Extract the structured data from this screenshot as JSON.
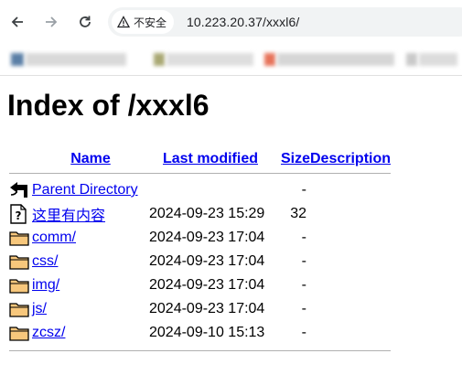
{
  "browser": {
    "security_label": "不安全",
    "url": "10.223.20.37/xxxl6/"
  },
  "page": {
    "title": "Index of /xxxl6",
    "headers": {
      "name": "Name",
      "last_modified": "Last modified",
      "size": "Size",
      "description": "Description"
    },
    "rows": [
      {
        "icon": "back-icon",
        "name": "Parent Directory",
        "date": "",
        "size": "-"
      },
      {
        "icon": "unknown-file-icon",
        "name": "这里有内容",
        "date": "2024-09-23 15:29",
        "size": "32"
      },
      {
        "icon": "folder-icon",
        "name": "comm/",
        "date": "2024-09-23 17:04",
        "size": "-"
      },
      {
        "icon": "folder-icon",
        "name": "css/",
        "date": "2024-09-23 17:04",
        "size": "-"
      },
      {
        "icon": "folder-icon",
        "name": "img/",
        "date": "2024-09-23 17:04",
        "size": "-"
      },
      {
        "icon": "folder-icon",
        "name": "js/",
        "date": "2024-09-23 17:04",
        "size": "-"
      },
      {
        "icon": "folder-icon",
        "name": "zcsz/",
        "date": "2024-09-10 15:13",
        "size": "-"
      }
    ]
  }
}
